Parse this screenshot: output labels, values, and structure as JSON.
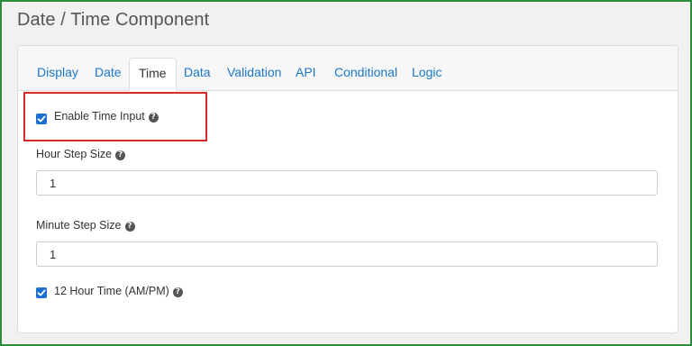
{
  "page": {
    "title": "Date / Time Component"
  },
  "tabs": [
    {
      "label": "Display"
    },
    {
      "label": "Date"
    },
    {
      "label": "Time",
      "active": true
    },
    {
      "label": "Data"
    },
    {
      "label": "Validation"
    },
    {
      "label": "API"
    },
    {
      "label": "Conditional"
    },
    {
      "label": "Logic"
    }
  ],
  "form": {
    "enable_time_input": {
      "label": "Enable Time Input",
      "checked": true
    },
    "hour_step_size": {
      "label": "Hour Step Size",
      "value": "1"
    },
    "minute_step_size": {
      "label": "Minute Step Size",
      "value": "1"
    },
    "twelve_hour_time": {
      "label": "12 Hour Time (AM/PM)",
      "checked": true
    }
  },
  "icons": {
    "help": "question-circle-icon",
    "check": "checkmark-icon"
  },
  "colors": {
    "accent": "#1a6fd1",
    "link": "#1a76c7",
    "frame": "#2e8b3a",
    "highlight": "#d42a2a"
  }
}
